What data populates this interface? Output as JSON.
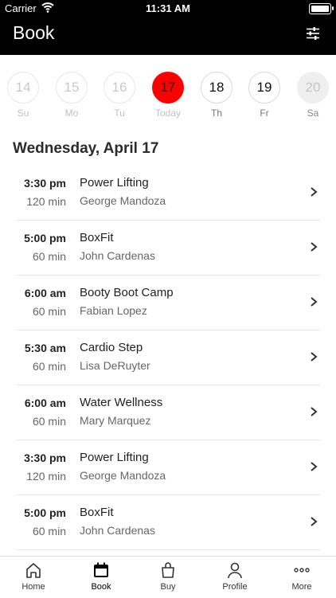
{
  "status": {
    "carrier": "Carrier",
    "time": "11:31 AM"
  },
  "header": {
    "title": "Book"
  },
  "week": [
    {
      "num": "14",
      "label": "Su",
      "state": "past"
    },
    {
      "num": "15",
      "label": "Mo",
      "state": "past"
    },
    {
      "num": "16",
      "label": "Tu",
      "state": "past"
    },
    {
      "num": "17",
      "label": "Today",
      "state": "today"
    },
    {
      "num": "18",
      "label": "Th",
      "state": "future"
    },
    {
      "num": "19",
      "label": "Fr",
      "state": "future"
    },
    {
      "num": "20",
      "label": "Sa",
      "state": "sat"
    }
  ],
  "date_heading": "Wednesday, April 17",
  "classes": [
    {
      "time": "3:30 pm",
      "duration": "120 min",
      "name": "Power Lifting",
      "instructor": "George Mandoza"
    },
    {
      "time": "5:00 pm",
      "duration": "60 min",
      "name": "BoxFit",
      "instructor": "John Cardenas"
    },
    {
      "time": "6:00 am",
      "duration": "60 min",
      "name": "Booty Boot Camp",
      "instructor": "Fabian Lopez"
    },
    {
      "time": "5:30 am",
      "duration": "60 min",
      "name": "Cardio Step",
      "instructor": "Lisa DeRuyter"
    },
    {
      "time": "6:00 am",
      "duration": "60 min",
      "name": "Water Wellness",
      "instructor": "Mary Marquez"
    },
    {
      "time": "3:30 pm",
      "duration": "120 min",
      "name": "Power Lifting",
      "instructor": "George Mandoza"
    },
    {
      "time": "5:00 pm",
      "duration": "60 min",
      "name": "BoxFit",
      "instructor": "John Cardenas"
    },
    {
      "time": "",
      "duration": "",
      "name": "",
      "instructor": ""
    }
  ],
  "tabs": [
    {
      "label": "Home",
      "icon": "home-icon"
    },
    {
      "label": "Book",
      "icon": "calendar-icon"
    },
    {
      "label": "Buy",
      "icon": "shopping-bag-icon"
    },
    {
      "label": "Profile",
      "icon": "profile-icon"
    },
    {
      "label": "More",
      "icon": "more-icon"
    }
  ],
  "colors": {
    "header_bg": "#000000",
    "today": "#ff0000",
    "active_tab": "#000000"
  }
}
